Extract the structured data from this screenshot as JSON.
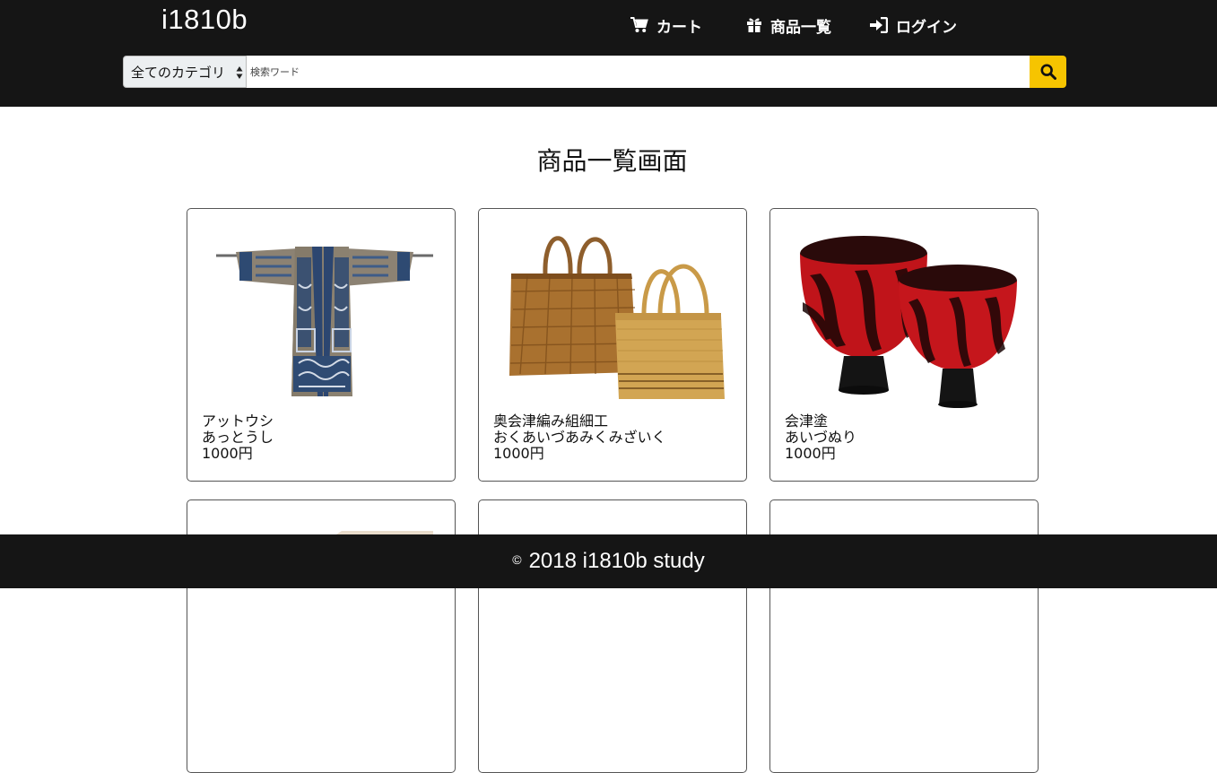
{
  "header": {
    "logo": "i1810b",
    "nav": {
      "cart": "カート",
      "products": "商品一覧",
      "login": "ログイン"
    },
    "search": {
      "category_selected": "全てのカテゴリ",
      "placeholder": "検索ワード"
    },
    "accent_color": "#f6c400",
    "bg_color": "#151515"
  },
  "main": {
    "title": "商品一覧画面",
    "products": [
      {
        "name": "アットウシ",
        "reading": "あっとうし",
        "price": "1000円",
        "image": "attush-robe"
      },
      {
        "name": "奥会津編み組細工",
        "reading": "おくあいづあみくみざいく",
        "price": "1000円",
        "image": "woven-baskets"
      },
      {
        "name": "会津塗",
        "reading": "あいづぬり",
        "price": "1000円",
        "image": "lacquer-bowls"
      }
    ]
  },
  "footer": {
    "copy_symbol": "©",
    "text": "2018 i1810b study"
  }
}
